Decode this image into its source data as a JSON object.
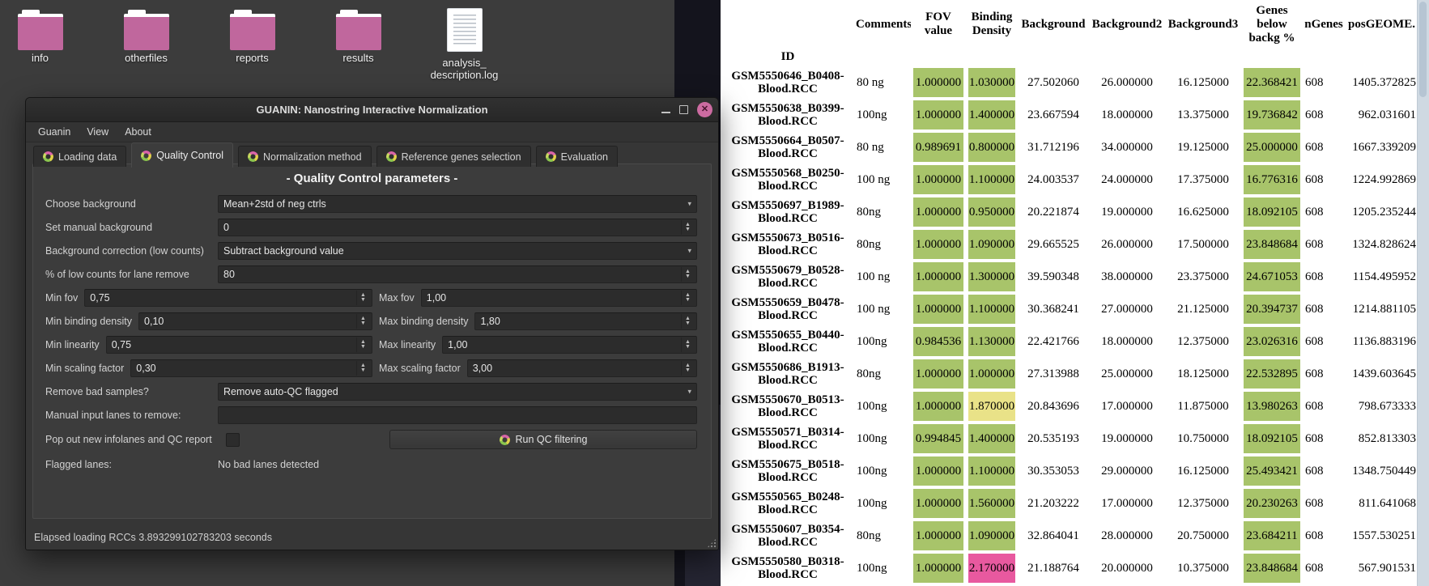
{
  "colors": {
    "cell_green": "#a8c46a",
    "cell_yellow": "#e9e288",
    "cell_pink": "#e8599f",
    "folder_pink": "#c0679d",
    "close_button_pink": "#cc6ba1"
  },
  "desktop": {
    "icons": [
      {
        "type": "folder",
        "label_lines": [
          "info"
        ]
      },
      {
        "type": "folder",
        "label_lines": [
          "otherfiles"
        ]
      },
      {
        "type": "folder",
        "label_lines": [
          "reports"
        ]
      },
      {
        "type": "folder",
        "label_lines": [
          "results"
        ]
      },
      {
        "type": "file",
        "label_lines": [
          "analysis_",
          "description.log"
        ]
      }
    ]
  },
  "window": {
    "title": "GUANIN: Nanostring Interactive Normalization",
    "menu": [
      "Guanin",
      "View",
      "About"
    ],
    "tabs": [
      {
        "label": "Loading data",
        "active": false
      },
      {
        "label": "Quality Control",
        "active": true
      },
      {
        "label": "Normalization method",
        "active": false
      },
      {
        "label": "Reference genes selection",
        "active": false
      },
      {
        "label": "Evaluation",
        "active": false
      }
    ],
    "heading": "- Quality Control parameters -",
    "form_rows": [
      {
        "kind": "full",
        "widget": "combo",
        "label": "Choose background",
        "value": "Mean+2std of neg ctrls"
      },
      {
        "kind": "full",
        "widget": "spin",
        "label": "Set manual background",
        "value": "0"
      },
      {
        "kind": "full",
        "widget": "combo",
        "label": "Background correction (low counts)",
        "value": "Subtract background value"
      },
      {
        "kind": "full",
        "widget": "spin",
        "label": "% of low counts for lane remove",
        "value": "80"
      },
      {
        "kind": "pair",
        "left": {
          "label": "Min fov",
          "value": "0,75"
        },
        "right": {
          "label": "Max fov",
          "value": "1,00"
        }
      },
      {
        "kind": "pair",
        "left": {
          "label": "Min binding density",
          "value": "0,10"
        },
        "right": {
          "label": "Max binding density",
          "value": "1,80"
        }
      },
      {
        "kind": "pair",
        "left": {
          "label": "Min linearity",
          "value": "0,75"
        },
        "right": {
          "label": "Max linearity",
          "value": "1,00"
        }
      },
      {
        "kind": "pair",
        "left": {
          "label": "Min scaling factor",
          "value": "0,30"
        },
        "right": {
          "label": "Max scaling factor",
          "value": "3,00"
        }
      },
      {
        "kind": "full",
        "widget": "combo",
        "label": "Remove bad samples?",
        "value": "Remove auto-QC flagged"
      },
      {
        "kind": "full",
        "widget": "text",
        "label": "Manual input lanes to remove:",
        "value": ""
      },
      {
        "kind": "actions",
        "label": "Pop out new infolanes and QC report",
        "checkbox_checked": false,
        "button_label": "Run QC filtering"
      },
      {
        "kind": "static",
        "label": "Flagged lanes:",
        "value": "No bad lanes detected"
      }
    ],
    "status": "Elapsed loading RCCs 3.893299102783203 seconds"
  },
  "table": {
    "index_name": "ID",
    "columns": [
      "Comments",
      "FOV value",
      "Binding Density",
      "Background",
      "Background2",
      "Background3",
      "Genes below backg %",
      "nGenes",
      "posGEOME."
    ],
    "rows": [
      {
        "id": "GSM5550646_B0408-Blood.RCC",
        "comments": "80 ng",
        "fov": "1.000000",
        "bd": "1.030000",
        "bd_level": "ok",
        "bg": "27.502060",
        "bg2": "26.000000",
        "bg3": "16.125000",
        "genes": "22.368421",
        "ngenes": "608",
        "pos": "1405.372825"
      },
      {
        "id": "GSM5550638_B0399-Blood.RCC",
        "comments": "100ng",
        "fov": "1.000000",
        "bd": "1.400000",
        "bd_level": "ok",
        "bg": "23.667594",
        "bg2": "18.000000",
        "bg3": "13.375000",
        "genes": "19.736842",
        "ngenes": "608",
        "pos": "962.031601"
      },
      {
        "id": "GSM5550664_B0507-Blood.RCC",
        "comments": "80 ng",
        "fov": "0.989691",
        "bd": "0.800000",
        "bd_level": "ok",
        "bg": "31.712196",
        "bg2": "34.000000",
        "bg3": "19.125000",
        "genes": "25.000000",
        "ngenes": "608",
        "pos": "1667.339209"
      },
      {
        "id": "GSM5550568_B0250-Blood.RCC",
        "comments": "100 ng",
        "fov": "1.000000",
        "bd": "1.100000",
        "bd_level": "ok",
        "bg": "24.003537",
        "bg2": "24.000000",
        "bg3": "17.375000",
        "genes": "16.776316",
        "ngenes": "608",
        "pos": "1224.992869"
      },
      {
        "id": "GSM5550697_B1989-Blood.RCC",
        "comments": "80ng",
        "fov": "1.000000",
        "bd": "0.950000",
        "bd_level": "ok",
        "bg": "20.221874",
        "bg2": "19.000000",
        "bg3": "16.625000",
        "genes": "18.092105",
        "ngenes": "608",
        "pos": "1205.235244"
      },
      {
        "id": "GSM5550673_B0516-Blood.RCC",
        "comments": "80ng",
        "fov": "1.000000",
        "bd": "1.090000",
        "bd_level": "ok",
        "bg": "29.665525",
        "bg2": "26.000000",
        "bg3": "17.500000",
        "genes": "23.848684",
        "ngenes": "608",
        "pos": "1324.828624"
      },
      {
        "id": "GSM5550679_B0528-Blood.RCC",
        "comments": "100 ng",
        "fov": "1.000000",
        "bd": "1.300000",
        "bd_level": "ok",
        "bg": "39.590348",
        "bg2": "38.000000",
        "bg3": "23.375000",
        "genes": "24.671053",
        "ngenes": "608",
        "pos": "1154.495952"
      },
      {
        "id": "GSM5550659_B0478-Blood.RCC",
        "comments": "100 ng",
        "fov": "1.000000",
        "bd": "1.100000",
        "bd_level": "ok",
        "bg": "30.368241",
        "bg2": "27.000000",
        "bg3": "21.125000",
        "genes": "20.394737",
        "ngenes": "608",
        "pos": "1214.881105"
      },
      {
        "id": "GSM5550655_B0440-Blood.RCC",
        "comments": "100ng",
        "fov": "0.984536",
        "bd": "1.130000",
        "bd_level": "ok",
        "bg": "22.421766",
        "bg2": "18.000000",
        "bg3": "12.375000",
        "genes": "23.026316",
        "ngenes": "608",
        "pos": "1136.883196"
      },
      {
        "id": "GSM5550686_B1913-Blood.RCC",
        "comments": "80ng",
        "fov": "1.000000",
        "bd": "1.000000",
        "bd_level": "ok",
        "bg": "27.313988",
        "bg2": "25.000000",
        "bg3": "18.125000",
        "genes": "22.532895",
        "ngenes": "608",
        "pos": "1439.603645"
      },
      {
        "id": "GSM5550670_B0513-Blood.RCC",
        "comments": "100ng",
        "fov": "1.000000",
        "bd": "1.870000",
        "bd_level": "warn",
        "bg": "20.843696",
        "bg2": "17.000000",
        "bg3": "11.875000",
        "genes": "13.980263",
        "ngenes": "608",
        "pos": "798.673333"
      },
      {
        "id": "GSM5550571_B0314-Blood.RCC",
        "comments": "100ng",
        "fov": "0.994845",
        "bd": "1.400000",
        "bd_level": "ok",
        "bg": "20.535193",
        "bg2": "19.000000",
        "bg3": "10.750000",
        "genes": "18.092105",
        "ngenes": "608",
        "pos": "852.813303"
      },
      {
        "id": "GSM5550675_B0518-Blood.RCC",
        "comments": "100ng",
        "fov": "1.000000",
        "bd": "1.100000",
        "bd_level": "ok",
        "bg": "30.353053",
        "bg2": "29.000000",
        "bg3": "16.125000",
        "genes": "25.493421",
        "ngenes": "608",
        "pos": "1348.750449"
      },
      {
        "id": "GSM5550565_B0248-Blood.RCC",
        "comments": "100ng",
        "fov": "1.000000",
        "bd": "1.560000",
        "bd_level": "ok",
        "bg": "21.203222",
        "bg2": "17.000000",
        "bg3": "12.375000",
        "genes": "20.230263",
        "ngenes": "608",
        "pos": "811.641068"
      },
      {
        "id": "GSM5550607_B0354-Blood.RCC",
        "comments": "80ng",
        "fov": "1.000000",
        "bd": "1.090000",
        "bd_level": "ok",
        "bg": "32.864041",
        "bg2": "28.000000",
        "bg3": "20.750000",
        "genes": "23.684211",
        "ngenes": "608",
        "pos": "1557.530251"
      },
      {
        "id": "GSM5550580_B0318-Blood.RCC",
        "comments": "100ng",
        "fov": "1.000000",
        "bd": "2.170000",
        "bd_level": "bad",
        "bg": "21.188764",
        "bg2": "20.000000",
        "bg3": "10.375000",
        "genes": "23.848684",
        "ngenes": "608",
        "pos": "567.901531"
      }
    ]
  }
}
